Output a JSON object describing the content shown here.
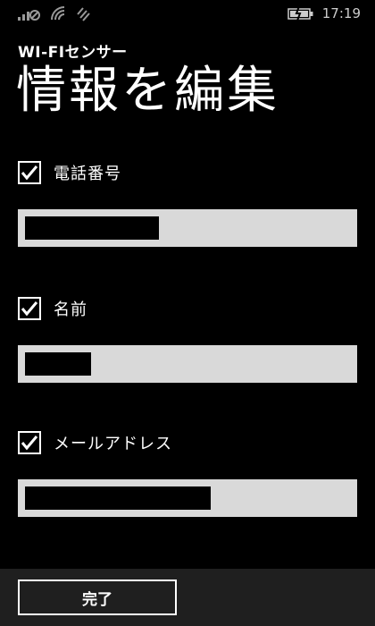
{
  "status_bar": {
    "time": "17:19",
    "icons": [
      "signal-strength-icon",
      "wifi-icon",
      "data-connection-icon",
      "battery-icon"
    ]
  },
  "app_title": "WI-FIセンサー",
  "page_title": "情報を編集",
  "fields": [
    {
      "label": "電話番号",
      "checked": true,
      "icon": "checkmark-icon"
    },
    {
      "label": "名前",
      "checked": true,
      "icon": "checkmark-icon"
    },
    {
      "label": "メールアドレス",
      "checked": true,
      "icon": "checkmark-icon"
    }
  ],
  "app_bar": {
    "done_label": "完了"
  },
  "colors": {
    "background": "#000000",
    "field_background": "#d9d9d9",
    "app_bar": "#1f1f1f",
    "text": "#ffffff"
  }
}
